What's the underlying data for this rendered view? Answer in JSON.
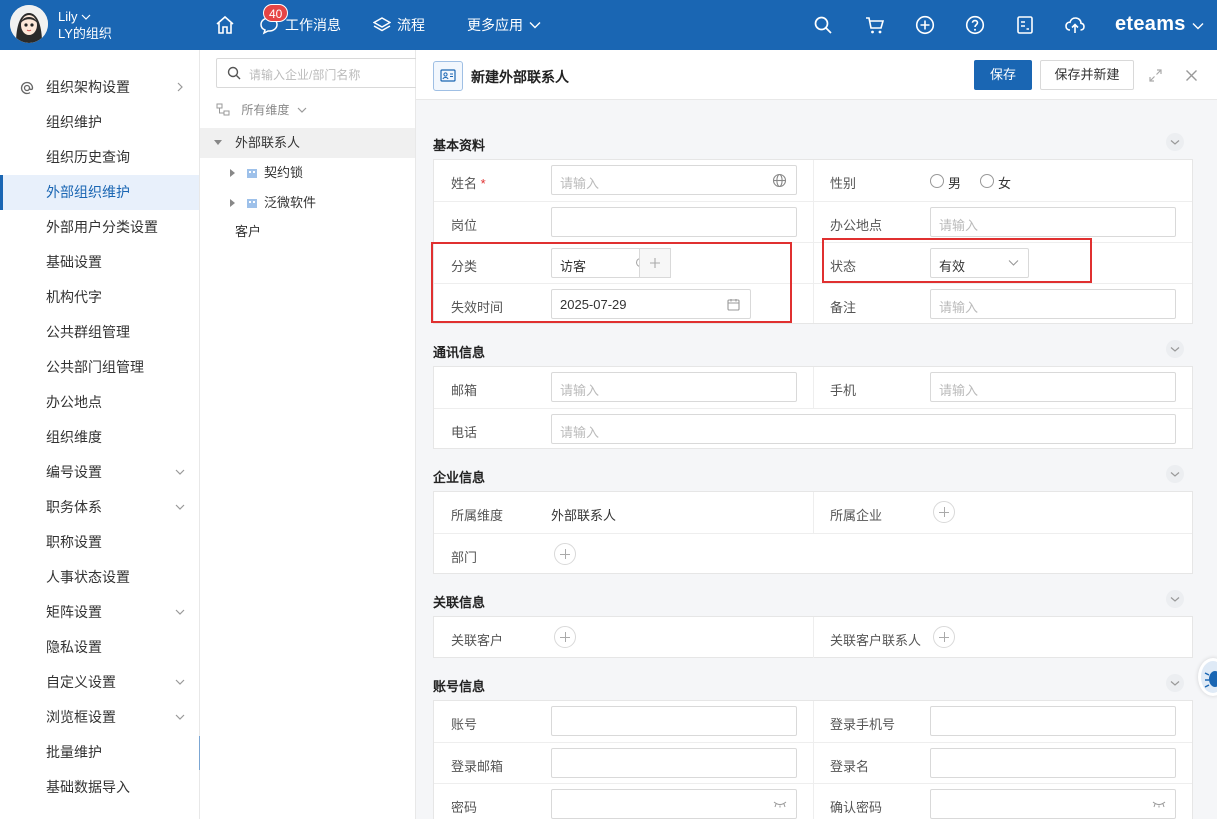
{
  "user": {
    "name": "Lily",
    "org": "LY的组织"
  },
  "topnav": {
    "messages_label": "工作消息",
    "messages_badge": "40",
    "flow_label": "流程",
    "more_apps_label": "更多应用",
    "brand": "eteams"
  },
  "sidebar": {
    "items": [
      {
        "label": "组织架构设置"
      },
      {
        "label": "组织维护"
      },
      {
        "label": "组织历史查询"
      },
      {
        "label": "外部组织维护"
      },
      {
        "label": "外部用户分类设置"
      },
      {
        "label": "基础设置"
      },
      {
        "label": "机构代字"
      },
      {
        "label": "公共群组管理"
      },
      {
        "label": "公共部门组管理"
      },
      {
        "label": "办公地点"
      },
      {
        "label": "组织维度"
      },
      {
        "label": "编号设置"
      },
      {
        "label": "职务体系"
      },
      {
        "label": "职称设置"
      },
      {
        "label": "人事状态设置"
      },
      {
        "label": "矩阵设置"
      },
      {
        "label": "隐私设置"
      },
      {
        "label": "自定义设置"
      },
      {
        "label": "浏览框设置"
      },
      {
        "label": "批量维护"
      },
      {
        "label": "基础数据导入"
      }
    ]
  },
  "tree": {
    "search_placeholder": "请输入企业/部门名称",
    "dimension_label": "所有维度",
    "root": "外部联系人",
    "children": [
      "契约锁",
      "泛微软件"
    ],
    "other": "客户"
  },
  "form": {
    "title": "新建外部联系人",
    "save": "保存",
    "save_and_new": "保存并新建",
    "sections": {
      "basic": "基本资料",
      "contact": "通讯信息",
      "company": "企业信息",
      "related": "关联信息",
      "account": "账号信息"
    },
    "fields": {
      "name": "姓名",
      "name_required": "*",
      "gender": "性别",
      "male": "男",
      "female": "女",
      "position": "岗位",
      "office": "办公地点",
      "category": "分类",
      "category_value": "访客",
      "status": "状态",
      "status_value": "有效",
      "expire": "失效时间",
      "expire_value": "2025-07-29",
      "remark": "备注",
      "email": "邮箱",
      "mobile": "手机",
      "phone": "电话",
      "dimension": "所属维度",
      "dimension_value": "外部联系人",
      "company": "所属企业",
      "department": "部门",
      "related_customer": "关联客户",
      "related_contact": "关联客户联系人",
      "account": "账号",
      "login_mobile": "登录手机号",
      "login_email": "登录邮箱",
      "login_name": "登录名",
      "password": "密码",
      "confirm_password": "确认密码"
    },
    "placeholder": "请输入"
  }
}
